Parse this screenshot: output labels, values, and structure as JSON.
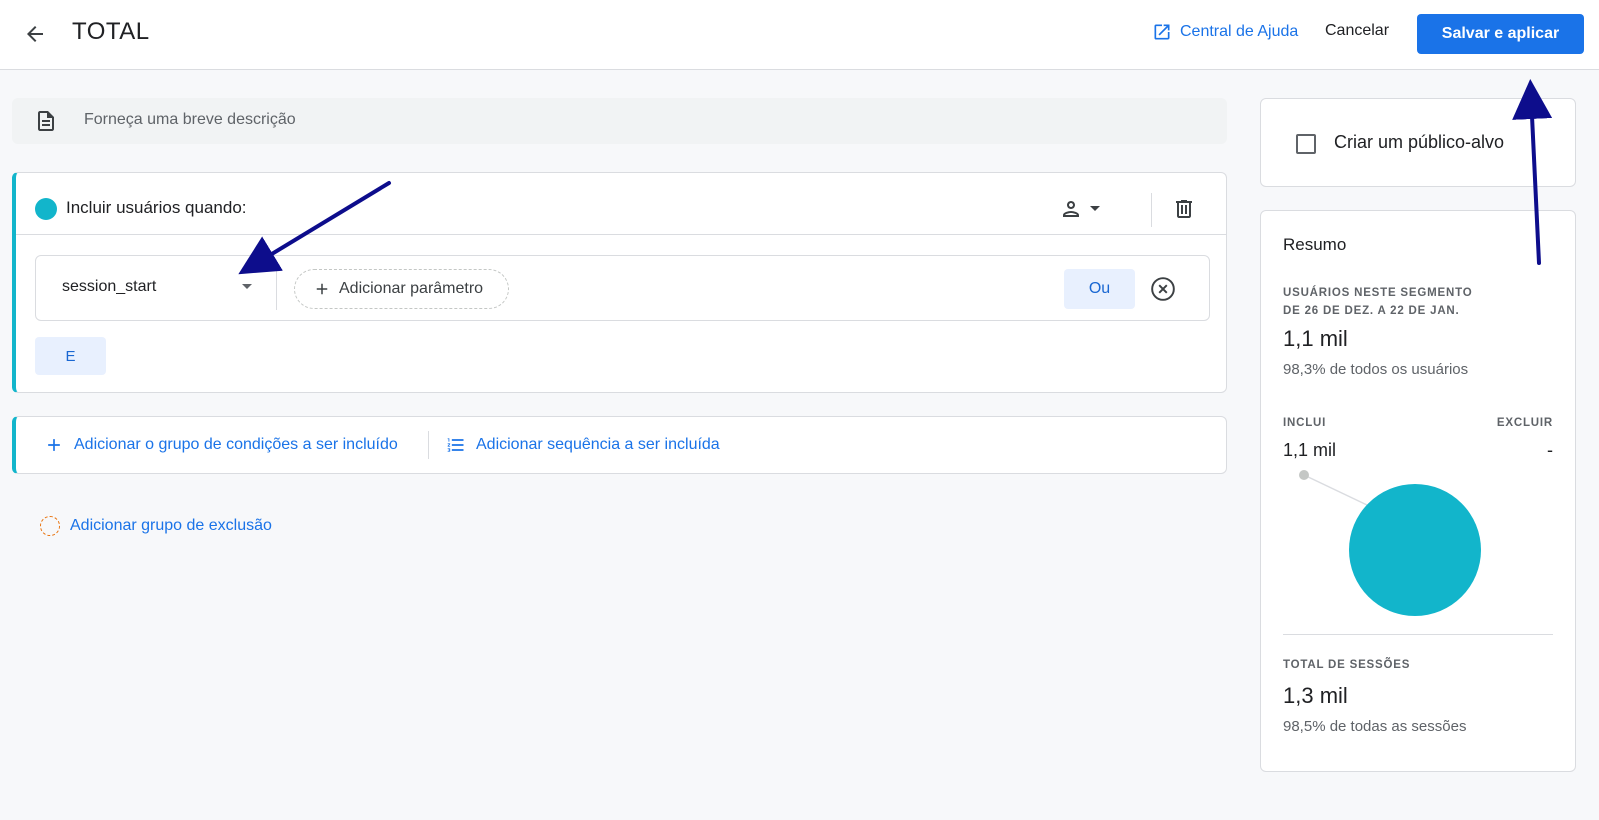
{
  "header": {
    "title": "TOTAL",
    "help_label": "Central de Ajuda",
    "cancel_label": "Cancelar",
    "save_label": "Salvar e aplicar"
  },
  "description": {
    "placeholder": "Forneça uma breve descrição"
  },
  "include_group": {
    "title": "Incluir usuários quando:",
    "event_name": "session_start",
    "add_parameter_label": "Adicionar parâmetro",
    "or_label": "Ou",
    "and_label": "E",
    "accent_color": "#12b5cb"
  },
  "add_actions": {
    "add_condition_group": "Adicionar o grupo de condições a ser incluído",
    "add_sequence": "Adicionar sequência a ser incluída",
    "add_exclusion": "Adicionar grupo de exclusão"
  },
  "audience": {
    "label": "Criar um público-alvo",
    "checked": false
  },
  "summary": {
    "title": "Resumo",
    "users_label_line1": "USUÁRIOS NESTE SEGMENTO",
    "users_label_line2": "DE 26 DE DEZ. A 22 DE JAN.",
    "users_value": "1,1 mil",
    "users_share": "98,3% de todos os usuários",
    "includes_label": "INCLUI",
    "excludes_label": "EXCLUIR",
    "includes_value": "1,1 mil",
    "excludes_value": "-",
    "sessions_label": "TOTAL DE SESSÕES",
    "sessions_value": "1,3 mil",
    "sessions_share": "98,5% de todas as sessões",
    "pie_color": "#12b5cb"
  },
  "colors": {
    "primary": "#1a73e8",
    "annotation_arrow": "#0d0d8c"
  }
}
